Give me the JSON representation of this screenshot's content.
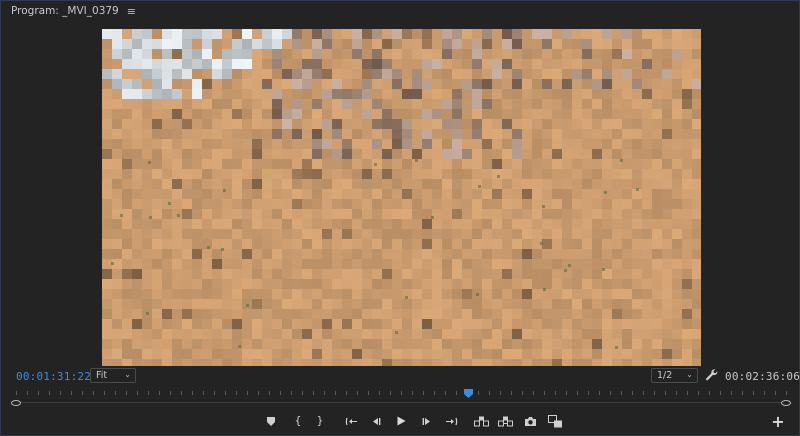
{
  "panel": {
    "title": "Program: _MVI_0379",
    "menu_icon": "hamburger-menu-icon"
  },
  "timecode": {
    "current": "00:01:31:22",
    "duration": "00:02:36:06"
  },
  "zoom": {
    "selected": "Fit"
  },
  "resolution": {
    "selected": "1/2"
  },
  "controls": {
    "in_label": "{",
    "out_label": "}",
    "icons": [
      "add-marker-icon",
      "mark-in-icon",
      "mark-out-icon",
      "go-to-in-icon",
      "step-back-icon",
      "play-icon",
      "step-forward-icon",
      "go-to-out-icon",
      "lift-icon",
      "extract-icon",
      "export-frame-icon",
      "comparison-view-icon",
      "button-editor-icon"
    ]
  },
  "playback": {
    "playhead_fraction": 0.588
  },
  "colors": {
    "accent": "#3b8de0",
    "background": "#232323"
  }
}
